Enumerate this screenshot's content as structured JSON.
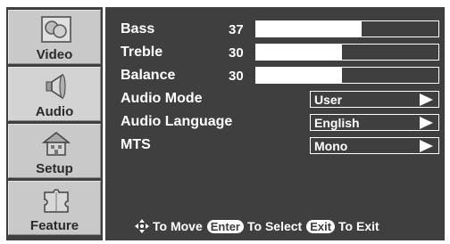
{
  "sidebar": {
    "tabs": [
      {
        "label": "Video",
        "icon": "video-screens-icon"
      },
      {
        "label": "Audio",
        "icon": "speaker-icon"
      },
      {
        "label": "Setup",
        "icon": "house-setup-icon"
      },
      {
        "label": "Feature",
        "icon": "puzzle-feature-icon"
      }
    ],
    "active": "Audio"
  },
  "audio_menu": {
    "bass": {
      "label": "Bass",
      "value": "37",
      "level": 37
    },
    "treble": {
      "label": "Treble",
      "value": "30",
      "level": 30
    },
    "balance": {
      "label": "Balance",
      "value": "30",
      "level": 30
    },
    "audio_mode": {
      "label": "Audio Mode",
      "value": "User"
    },
    "audio_language": {
      "label": "Audio Language",
      "value": "English"
    },
    "mts": {
      "label": "MTS",
      "value": "Mono"
    }
  },
  "footer": {
    "move_text": "To Move",
    "enter_key": "Enter",
    "select_text": "To Select",
    "exit_key": "Exit",
    "exit_text": "To Exit"
  },
  "colors": {
    "panel": "#3f3f3f",
    "tab": "#c9c9c9",
    "text": "#ffffff"
  }
}
